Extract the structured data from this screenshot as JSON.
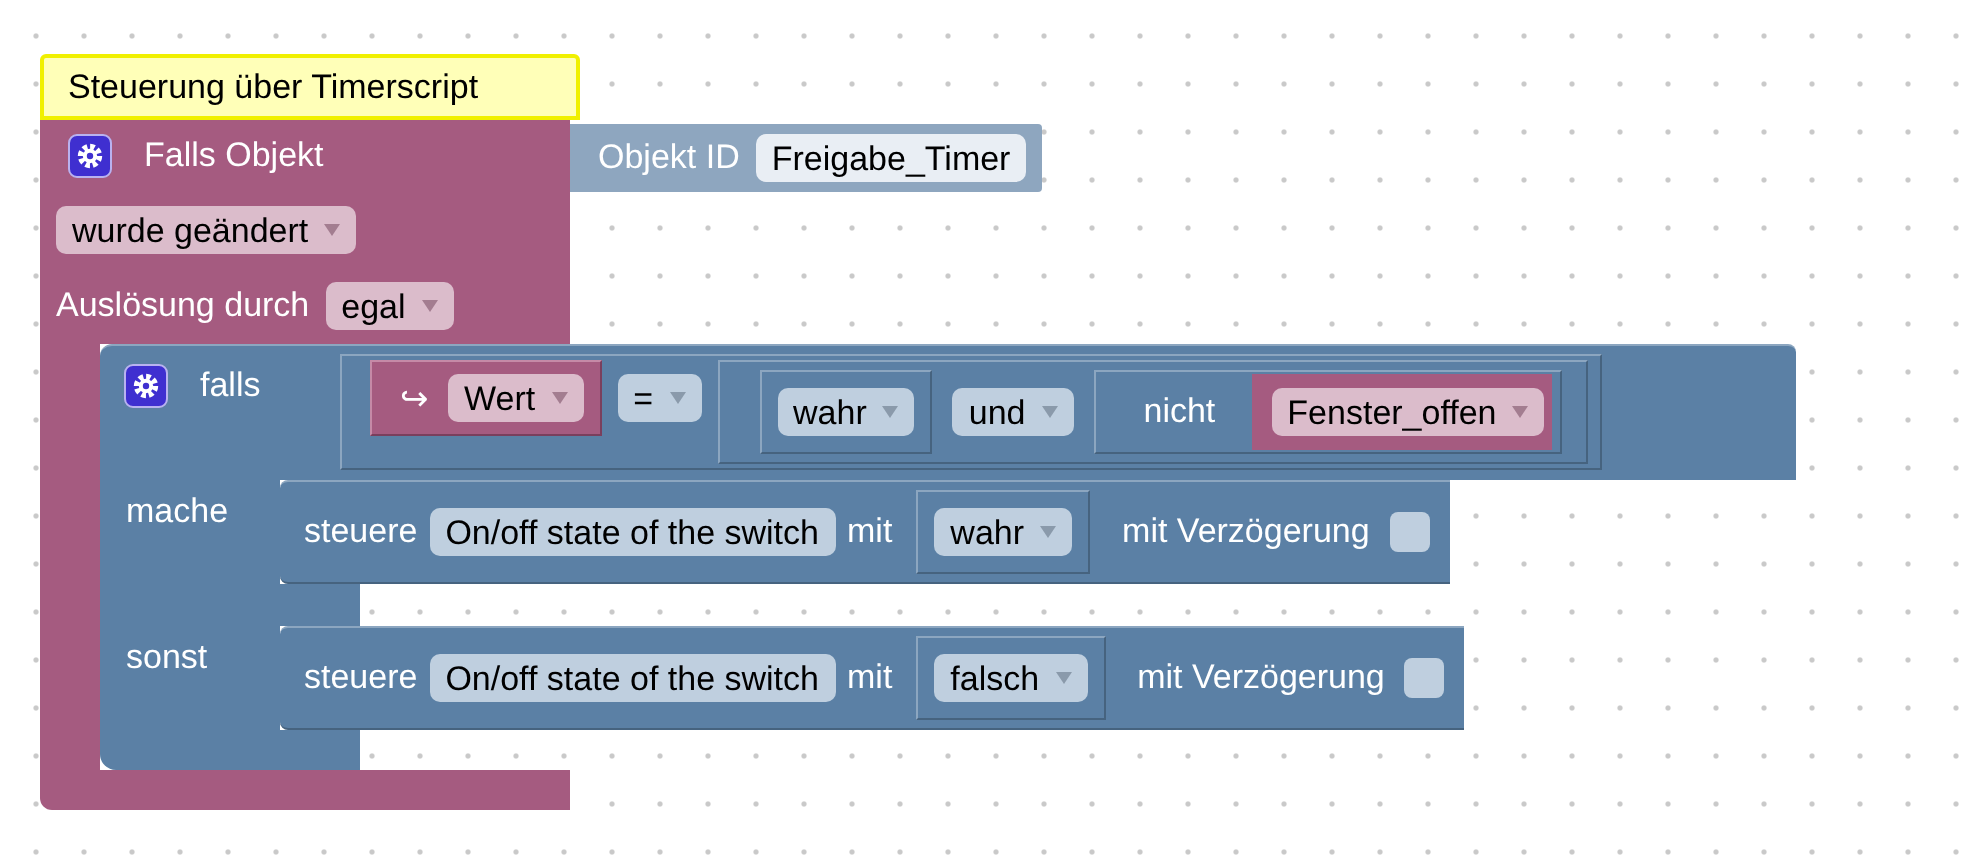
{
  "comment": "Steuerung über Timerscript",
  "trigger": {
    "label": "Falls Objekt",
    "object": {
      "label": "Objekt ID",
      "value": "Freigabe_Timer"
    },
    "event": "wurde geändert",
    "source_label": "Auslösung durch",
    "source": "egal"
  },
  "if_block": {
    "label": "falls",
    "condition": {
      "left": {
        "arrow": "↪",
        "value": "Wert"
      },
      "operator": "=",
      "right": {
        "left": "wahr",
        "operator": "und",
        "right": {
          "label": "nicht",
          "value": "Fenster_offen"
        }
      }
    },
    "branches": [
      {
        "label": "mache",
        "statement": {
          "label": "steuere",
          "target": "On/off state of the switch",
          "with_label": "mit",
          "value": "wahr",
          "delay_label": "mit Verzögerung",
          "delay": false
        }
      },
      {
        "label": "sonst",
        "statement": {
          "label": "steuere",
          "target": "On/off state of the switch",
          "with_label": "mit",
          "value": "falsch",
          "delay_label": "mit Verzögerung",
          "delay": false
        }
      }
    ]
  }
}
